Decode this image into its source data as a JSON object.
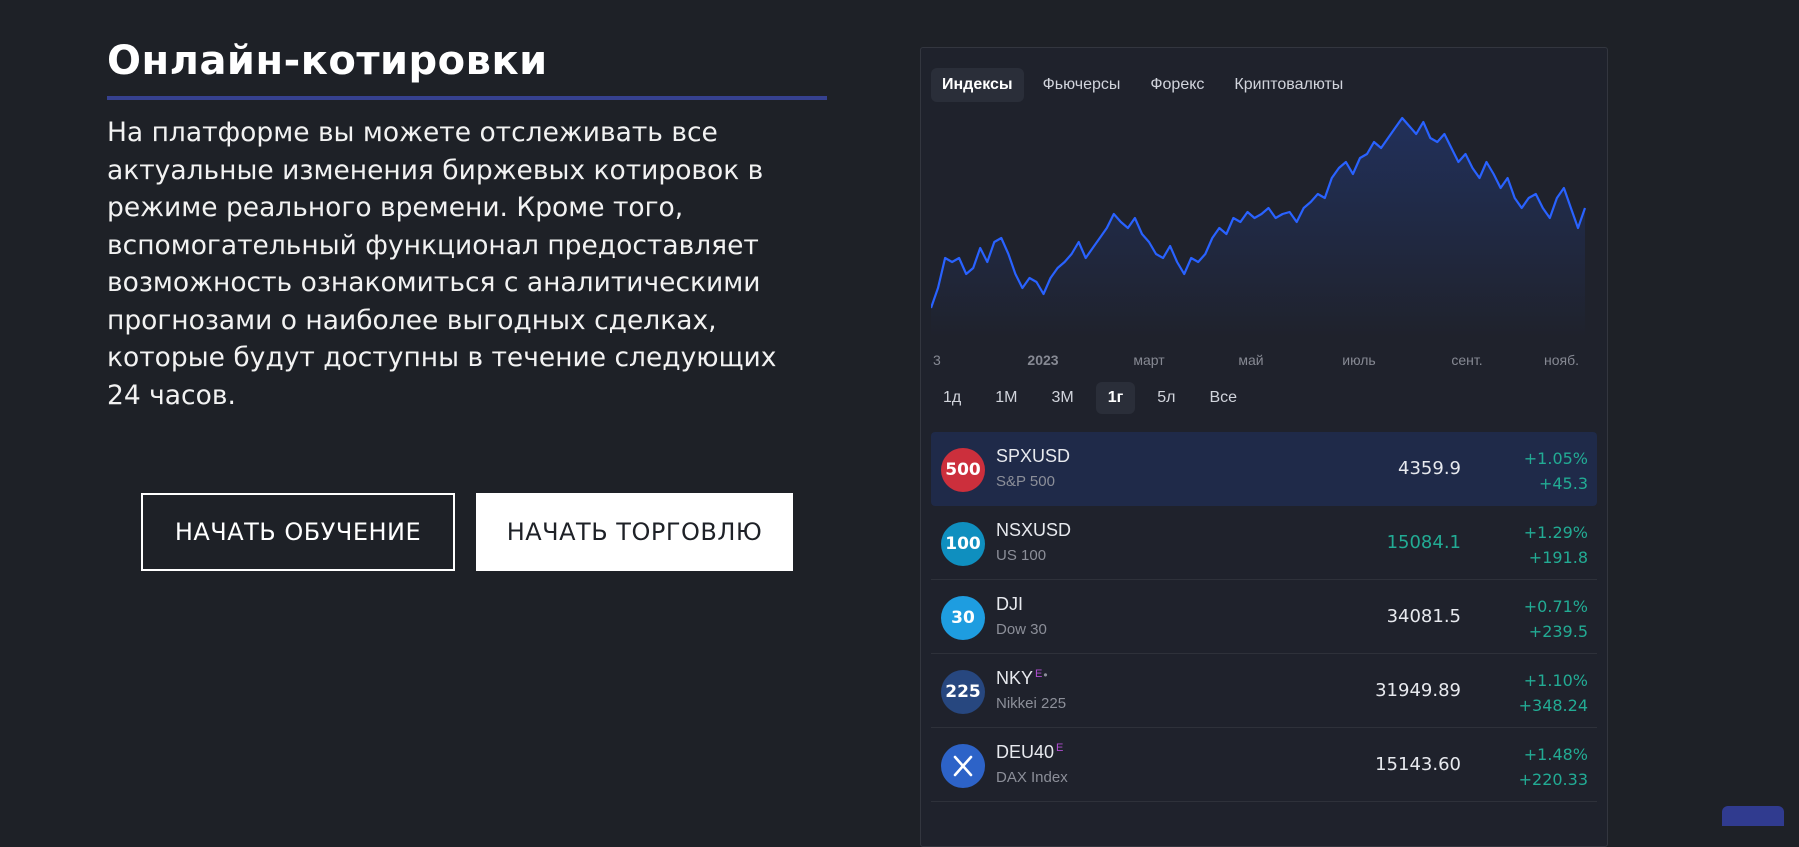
{
  "heading": {
    "title": "Онлайн-котировки",
    "lines": [
      "На платформе вы можете отслеживать все",
      "актуальные изменения биржевых котировок в",
      "режиме реального времени. Кроме того,",
      "вспомогательный функционал предоставляет",
      "возможность ознакомиться с аналитическими",
      "прогнозами о наиболее выгодных сделках,",
      "которые будут доступны в течение следующих",
      "24 часов."
    ]
  },
  "buttons": {
    "learn": "НАЧАТЬ ОБУЧЕНИЕ",
    "trade": "НАЧАТЬ ТОРГОВЛЮ"
  },
  "widget": {
    "tabs": [
      "Индексы",
      "Фьючерсы",
      "Форекс",
      "Криптовалюты"
    ],
    "active_tab": 0,
    "ranges": [
      "1д",
      "1М",
      "3М",
      "1г",
      "5л",
      "Все"
    ],
    "active_range": 3,
    "accent_color": "#2962ff",
    "rows": [
      {
        "logo": "500",
        "logo_color": "#cc2f3c",
        "symbol": "SPXUSD",
        "sup": "",
        "name": "S&P 500",
        "price": "4359.9",
        "price_up": false,
        "pct": "+1.05%",
        "abs": "+45.3"
      },
      {
        "logo": "100",
        "logo_color": "#0f8fbf",
        "symbol": "NSXUSD",
        "sup": "",
        "name": "US 100",
        "price": "15084.1",
        "price_up": true,
        "pct": "+1.29%",
        "abs": "+191.8"
      },
      {
        "logo": "30",
        "logo_color": "#1e9de0",
        "symbol": "DJI",
        "sup": "",
        "name": "Dow 30",
        "price": "34081.5",
        "price_up": false,
        "pct": "+0.71%",
        "abs": "+239.5"
      },
      {
        "logo": "225",
        "logo_color": "#27477f",
        "symbol": "NKY",
        "sup": "E",
        "dot": "•",
        "name": "Nikkei 225",
        "price": "31949.89",
        "price_up": false,
        "pct": "+1.10%",
        "abs": "+348.24"
      },
      {
        "logo": "x-logo-icon",
        "logo_color": "#2d63c8",
        "symbol": "DEU40",
        "sup": "E",
        "name": "DAX Index",
        "price": "15143.60",
        "price_up": false,
        "pct": "+1.48%",
        "abs": "+220.33"
      }
    ]
  },
  "chart_data": {
    "type": "area",
    "xlabel": "",
    "ylabel": "",
    "ylim": [
      0,
      100
    ],
    "grid": false,
    "x_tick_labels": [
      "3",
      "2023",
      "март",
      "май",
      "июль",
      "сент.",
      "нояб."
    ],
    "values": [
      5,
      15,
      30,
      28,
      30,
      22,
      25,
      35,
      28,
      38,
      40,
      32,
      22,
      15,
      20,
      18,
      12,
      20,
      25,
      28,
      32,
      38,
      30,
      35,
      40,
      45,
      52,
      48,
      45,
      50,
      42,
      38,
      32,
      30,
      36,
      28,
      22,
      30,
      28,
      32,
      40,
      45,
      42,
      50,
      48,
      53,
      50,
      52,
      55,
      50,
      52,
      53,
      48,
      55,
      58,
      62,
      60,
      70,
      75,
      78,
      72,
      80,
      82,
      88,
      85,
      90,
      95,
      100,
      96,
      92,
      98,
      90,
      88,
      92,
      85,
      78,
      82,
      75,
      70,
      78,
      72,
      65,
      70,
      60,
      55,
      60,
      62,
      55,
      50,
      60,
      65,
      55,
      45,
      55
    ]
  }
}
